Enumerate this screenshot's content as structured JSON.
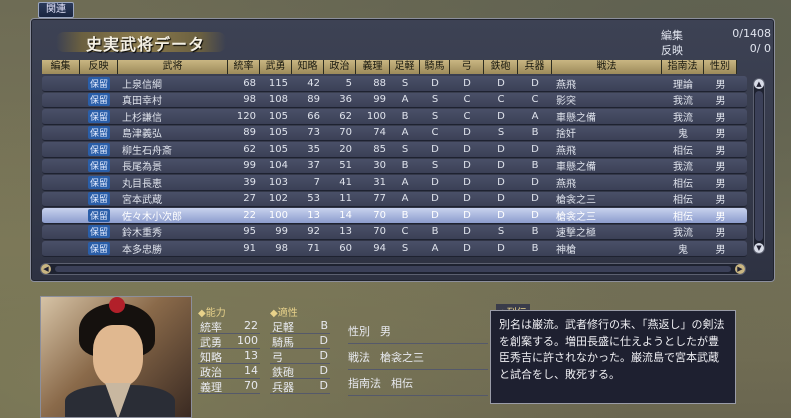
{
  "top_tag": "関連",
  "title": "史実武将データ",
  "counter": {
    "edit_label": "編集",
    "edit_value": "0/1408",
    "reflect_label": "反映",
    "reflect_value_a": "0",
    "reflect_value_b": "0"
  },
  "columns": [
    "編集",
    "反映",
    "武将",
    "統率",
    "武勇",
    "知略",
    "政治",
    "義理",
    "足軽",
    "騎馬",
    "弓",
    "鉄砲",
    "兵器",
    "戦法",
    "指南法",
    "性別"
  ],
  "rows": [
    {
      "badge": "保留",
      "name": "上泉信綱",
      "t": "68",
      "b": "115",
      "c": "42",
      "p": "5",
      "g": "88",
      "a1": "S",
      "a2": "D",
      "a3": "D",
      "a4": "D",
      "a5": "D",
      "tac": "燕飛",
      "teach": "理論",
      "sex": "男"
    },
    {
      "badge": "保留",
      "name": "真田幸村",
      "t": "98",
      "b": "108",
      "c": "89",
      "p": "36",
      "g": "99",
      "a1": "A",
      "a2": "S",
      "a3": "C",
      "a4": "C",
      "a5": "C",
      "tac": "影突",
      "teach": "我流",
      "sex": "男"
    },
    {
      "badge": "保留",
      "name": "上杉謙信",
      "t": "120",
      "b": "105",
      "c": "66",
      "p": "62",
      "g": "100",
      "a1": "B",
      "a2": "S",
      "a3": "C",
      "a4": "D",
      "a5": "A",
      "tac": "車懸之備",
      "teach": "我流",
      "sex": "男"
    },
    {
      "badge": "保留",
      "name": "島津義弘",
      "t": "89",
      "b": "105",
      "c": "73",
      "p": "70",
      "g": "74",
      "a1": "A",
      "a2": "C",
      "a3": "D",
      "a4": "S",
      "a5": "B",
      "tac": "捨奸",
      "teach": "鬼",
      "sex": "男"
    },
    {
      "badge": "保留",
      "name": "柳生石舟斎",
      "t": "62",
      "b": "105",
      "c": "35",
      "p": "20",
      "g": "85",
      "a1": "S",
      "a2": "D",
      "a3": "D",
      "a4": "D",
      "a5": "D",
      "tac": "燕飛",
      "teach": "相伝",
      "sex": "男"
    },
    {
      "badge": "保留",
      "name": "長尾為景",
      "t": "99",
      "b": "104",
      "c": "37",
      "p": "51",
      "g": "30",
      "a1": "B",
      "a2": "S",
      "a3": "D",
      "a4": "D",
      "a5": "B",
      "tac": "車懸之備",
      "teach": "我流",
      "sex": "男"
    },
    {
      "badge": "保留",
      "name": "丸目長恵",
      "t": "39",
      "b": "103",
      "c": "7",
      "p": "41",
      "g": "31",
      "a1": "A",
      "a2": "D",
      "a3": "D",
      "a4": "D",
      "a5": "D",
      "tac": "燕飛",
      "teach": "相伝",
      "sex": "男"
    },
    {
      "badge": "保留",
      "name": "宮本武蔵",
      "t": "27",
      "b": "102",
      "c": "53",
      "p": "11",
      "g": "77",
      "a1": "A",
      "a2": "D",
      "a3": "D",
      "a4": "D",
      "a5": "D",
      "tac": "槍衾之三",
      "teach": "相伝",
      "sex": "男"
    },
    {
      "badge": "保留",
      "name": "佐々木小次郎",
      "t": "22",
      "b": "100",
      "c": "13",
      "p": "14",
      "g": "70",
      "a1": "B",
      "a2": "D",
      "a3": "D",
      "a4": "D",
      "a5": "D",
      "tac": "槍衾之三",
      "teach": "相伝",
      "sex": "男",
      "selected": true
    },
    {
      "badge": "保留",
      "name": "鈴木重秀",
      "t": "95",
      "b": "99",
      "c": "92",
      "p": "13",
      "g": "70",
      "a1": "C",
      "a2": "B",
      "a3": "D",
      "a4": "S",
      "a5": "B",
      "tac": "速撃之極",
      "teach": "我流",
      "sex": "男"
    },
    {
      "badge": "保留",
      "name": "本多忠勝",
      "t": "91",
      "b": "98",
      "c": "71",
      "p": "60",
      "g": "94",
      "a1": "S",
      "a2": "A",
      "a3": "D",
      "a4": "D",
      "a5": "B",
      "tac": "神槍",
      "teach": "鬼",
      "sex": "男"
    }
  ],
  "detail": {
    "ability_label": "能力",
    "ability": [
      {
        "k": "統率",
        "v": "22"
      },
      {
        "k": "武勇",
        "v": "100"
      },
      {
        "k": "知略",
        "v": "13"
      },
      {
        "k": "政治",
        "v": "14"
      },
      {
        "k": "義理",
        "v": "70"
      }
    ],
    "aptitude_label": "適性",
    "aptitude": [
      {
        "k": "足軽",
        "v": "B"
      },
      {
        "k": "騎馬",
        "v": "D"
      },
      {
        "k": "弓",
        "v": "D"
      },
      {
        "k": "鉄砲",
        "v": "D"
      },
      {
        "k": "兵器",
        "v": "D"
      }
    ],
    "sex_label": "性別",
    "sex_value": "男",
    "tactic_label": "戦法",
    "tactic_value": "槍衾之三",
    "teach_label": "指南法",
    "teach_value": "相伝",
    "bio_label": "列伝",
    "bio_text": "別名は巌流。武者修行の末、「燕返し」の剣法を創案する。増田長盛に仕えようとしたが豊臣秀吉に許されなかった。巌流島で宮本武蔵と試合をし、敗死する。"
  }
}
